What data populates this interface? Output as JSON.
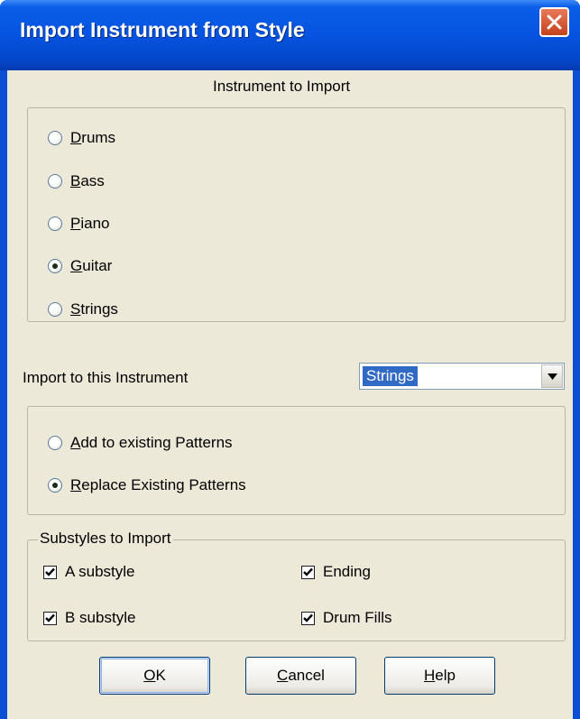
{
  "window": {
    "title": "Import Instrument from Style"
  },
  "instrument_section": {
    "heading": "Instrument to Import",
    "options": [
      {
        "label": "Drums",
        "mnemonic": "D",
        "rest": "rums",
        "selected": false
      },
      {
        "label": "Bass",
        "mnemonic": "B",
        "rest": "ass",
        "selected": false
      },
      {
        "label": "Piano",
        "mnemonic": "P",
        "rest": "iano",
        "selected": false
      },
      {
        "label": "Guitar",
        "mnemonic": "G",
        "rest": "uitar",
        "selected": true
      },
      {
        "label": "Strings",
        "mnemonic": "S",
        "rest": "trings",
        "selected": false
      }
    ]
  },
  "target": {
    "label": "Import to this Instrument",
    "selected_value": "Strings"
  },
  "pattern_mode": {
    "options": [
      {
        "label": "Add to existing Patterns",
        "mnemonic": "A",
        "rest": "dd to existing Patterns",
        "selected": false
      },
      {
        "label": "Replace Existing Patterns",
        "mnemonic": "R",
        "rest": "eplace Existing Patterns",
        "selected": true
      }
    ]
  },
  "substyles": {
    "legend": "Substyles to Import",
    "items": [
      {
        "label": "A substyle",
        "checked": true
      },
      {
        "label": "Ending",
        "checked": true
      },
      {
        "label": "B substyle",
        "checked": true
      },
      {
        "label": "Drum Fills",
        "checked": true
      }
    ]
  },
  "buttons": {
    "ok": {
      "mnemonic": "O",
      "rest": "K"
    },
    "cancel": {
      "mnemonic": "C",
      "rest": "ancel"
    },
    "help": {
      "mnemonic": "H",
      "rest": "elp"
    }
  },
  "colors": {
    "titlebar": "#0553e0",
    "face": "#ece9d8",
    "selection": "#316ac5",
    "close": "#c4421d"
  },
  "icons": [
    "close-icon",
    "dropdown-arrow-icon",
    "checkmark-icon"
  ]
}
